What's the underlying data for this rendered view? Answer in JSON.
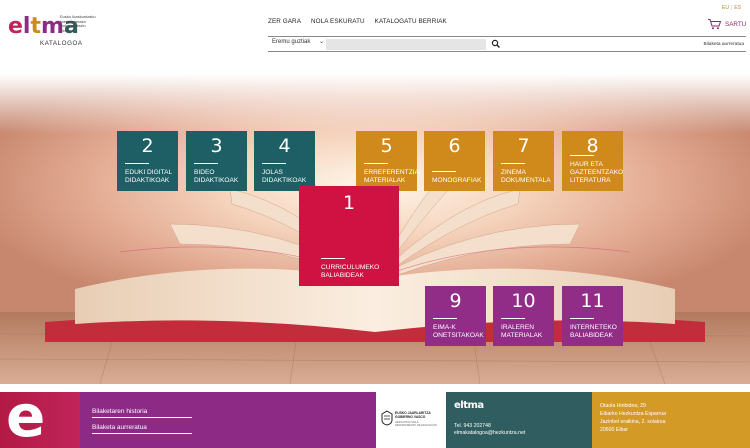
{
  "header": {
    "logo": {
      "word": [
        "e",
        "l",
        "t",
        "m",
        "a"
      ],
      "word_colors": [
        "#c0245a",
        "#8c2a86",
        "#d08a1c",
        "#8c2a86",
        "#2f5d60"
      ],
      "tagline": [
        "Eusko Ikaskuntzako",
        "Ikastetxeetako",
        "Dokumentazio",
        "Zentroa"
      ],
      "sub": "KATALOGOA"
    },
    "nav": [
      "ZER GARA",
      "NOLA ESKURATU",
      "KATALOGATU BERRIAK"
    ],
    "lang": {
      "eu": "EU",
      "sep": "|",
      "es": "ES"
    },
    "cart_label": "SARTU",
    "search": {
      "scope": "Eremu guztiak",
      "query": "",
      "button_icon": "search-icon"
    },
    "advanced_search": "Bilaketa aurreratua"
  },
  "tiles": [
    {
      "num": "2",
      "label": "EDUKI DIGITAL DIDAKTIKOAK",
      "color": "teal"
    },
    {
      "num": "3",
      "label": "BIDEO DIDAKTIKOAK",
      "color": "teal"
    },
    {
      "num": "4",
      "label": "JOLAS DIDAKTIKOAK",
      "color": "teal"
    },
    {
      "num": "5",
      "label": "ERREFERENTZIA-MATERIALAK",
      "color": "gold"
    },
    {
      "num": "6",
      "label": "MONOGRAFIAK",
      "color": "gold"
    },
    {
      "num": "7",
      "label": "ZINEMA DOKUMENTALA",
      "color": "gold"
    },
    {
      "num": "8",
      "label": "HAUR ETA GAZTEENTZAKO LITERATURA",
      "color": "gold"
    },
    {
      "num": "1",
      "label": "CURRICULUMEKO BALIABIDEAK",
      "color": "red"
    },
    {
      "num": "9",
      "label": "EIMA-K ONETSITAKOAK",
      "color": "purple"
    },
    {
      "num": "10",
      "label": "IRALEREN MATERIALAK",
      "color": "purple"
    },
    {
      "num": "11",
      "label": "INTERNETEKO BALIABIDEAK",
      "color": "purple"
    }
  ],
  "colors": {
    "teal": "#1d5f64",
    "gold": "#d08a1c",
    "red": "#d01242",
    "purple": "#922d87"
  },
  "footer": {
    "e_letter": "e",
    "links": [
      "Bilaketaren historia",
      "Bilaketa aurreratua"
    ],
    "gov": {
      "lines": [
        "EUSKO JAURLARITZA",
        "GOBIERNO VASCO"
      ],
      "small": [
        "HEZKUNTZA SAILA",
        "DEPARTAMENTO DE EDUCACIÓN"
      ]
    },
    "contact": {
      "logo": "eltma",
      "tel": "Tel. 943 202748",
      "email": "elmakatalogoa@hezkuntza.net"
    },
    "address": [
      "Otaola Hiribidea, 29",
      "Eibarko Hezkuntza Esparrua",
      "Jazinbel eraikina, 2. solairua",
      "20600 Eibar"
    ]
  }
}
